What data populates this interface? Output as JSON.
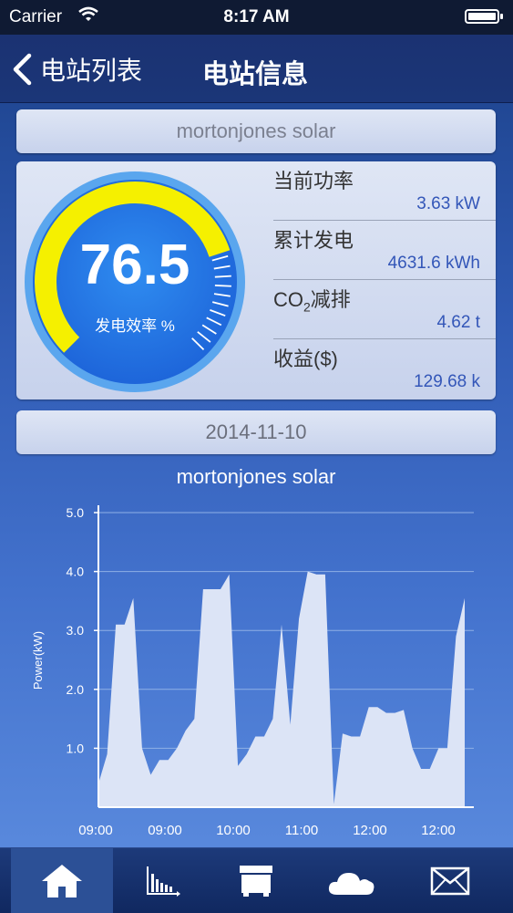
{
  "status_bar": {
    "carrier": "Carrier",
    "time": "8:17 AM"
  },
  "nav": {
    "back_label": "电站列表",
    "title": "电站信息"
  },
  "station_name": "mortonjones solar",
  "gauge": {
    "value": "76.5",
    "label": "发电效率 %",
    "fraction": 0.765,
    "ring_color": "#f5f000"
  },
  "metrics": [
    {
      "label": "当前功率",
      "value": "3.63 kW"
    },
    {
      "label": "累计发电",
      "value": "4631.6 kWh"
    },
    {
      "label_main": "CO",
      "label_sub": "2",
      "label_tail": "减排",
      "value": "4.62 t"
    },
    {
      "label": "收益($)",
      "value": "129.68 k"
    }
  ],
  "date": "2014-11-10",
  "chart_data": {
    "type": "area",
    "title": "mortonjones solar",
    "ylabel": "Power(kW)",
    "xlabel": "",
    "ylim": [
      0,
      5
    ],
    "y_ticks": [
      "5.0",
      "4.0",
      "3.0",
      "2.0",
      "1.0"
    ],
    "x_tick_labels": [
      "09:00",
      "09:00",
      "10:00",
      "11:00",
      "12:00",
      "12:00"
    ],
    "grid": true,
    "fill_color": "#dce4f6",
    "x": [
      0,
      1,
      2,
      3,
      4,
      5,
      6,
      7,
      8,
      9,
      10,
      11,
      12,
      13,
      14,
      15,
      16,
      17,
      18,
      19,
      20,
      21,
      22,
      23,
      24,
      25,
      26,
      27,
      28,
      29,
      30,
      31,
      32,
      33,
      34,
      35,
      36,
      37,
      38,
      39,
      40,
      41,
      42,
      43,
      44,
      45,
      46,
      47,
      48,
      49,
      50,
      51,
      52,
      53,
      54,
      55
    ],
    "values": [
      0.4,
      0.9,
      3.1,
      3.1,
      3.55,
      1.0,
      0.55,
      0.8,
      0.8,
      1.0,
      1.3,
      1.5,
      3.7,
      3.7,
      3.7,
      3.95,
      0.7,
      0.9,
      1.2,
      1.2,
      1.5,
      3.1,
      1.4,
      3.2,
      4.0,
      3.95,
      3.95,
      0.05,
      1.25,
      1.2,
      1.2,
      1.7,
      1.7,
      1.6,
      1.6,
      1.65,
      1.0,
      0.65,
      0.65,
      1.0,
      1.0,
      2.9,
      3.55,
      0.0,
      0.0,
      0.0,
      0.0,
      0.0,
      0.0,
      0.0,
      0.0,
      0.0,
      0.0,
      0.0,
      0.0,
      0.0
    ],
    "series": [
      {
        "values_count": 43
      }
    ]
  },
  "tabs": [
    {
      "icon": "home-icon"
    },
    {
      "icon": "bar-chart-icon"
    },
    {
      "icon": "device-icon"
    },
    {
      "icon": "weather-icon"
    },
    {
      "icon": "mail-icon"
    }
  ]
}
